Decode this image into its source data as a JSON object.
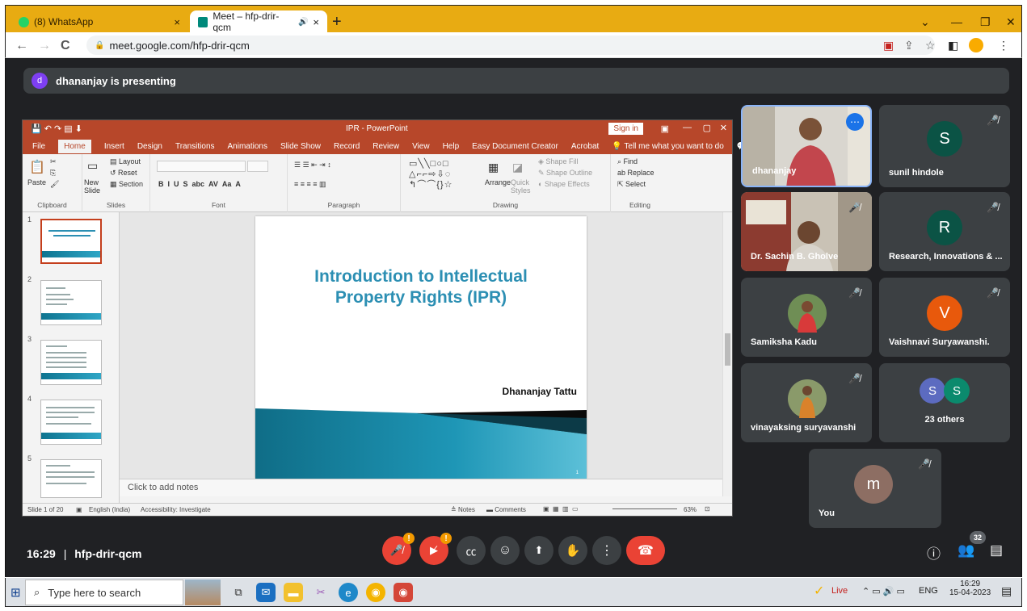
{
  "browser": {
    "tabs": [
      {
        "label": "(8) WhatsApp",
        "close": "×",
        "color": "#25d366"
      },
      {
        "label": "Meet – hfp-drir-qcm",
        "close": "×",
        "audio": "🔊",
        "color": "#00897b"
      }
    ],
    "new_tab": "+",
    "url": "meet.google.com/hfp-drir-qcm",
    "frame_color": "#e8ab12"
  },
  "meet": {
    "presenter_initial": "d",
    "presenting_text": "dhananjay is presenting",
    "time": "16:29",
    "separator": "|",
    "meeting_code": "hfp-drir-qcm",
    "participants_badge": "32",
    "warn_glyph": "!",
    "tiles": [
      {
        "name": "dhananjay",
        "type": "video"
      },
      {
        "name": "sunil hindole",
        "initial": "S",
        "color": "#0b5345"
      },
      {
        "name": "Dr. Sachin B. Gholve",
        "type": "video"
      },
      {
        "name": "Research, Innovations & ...",
        "initial": "R",
        "color": "#0b5345"
      },
      {
        "name": "Samiksha Kadu",
        "type": "photo"
      },
      {
        "name": "Vaishnavi Suryawanshi.",
        "initial": "V",
        "color": "#e8590c"
      },
      {
        "name": "vinayaksing suryavanshi",
        "type": "photo"
      },
      {
        "name": "23 others",
        "initials": [
          "S",
          "S"
        ],
        "colors": [
          "#5c6bc0",
          "#0b8a6d"
        ]
      },
      {
        "name": "You",
        "initial": "m",
        "color": "#8d6e63"
      }
    ]
  },
  "ppt": {
    "title": "IPR - PowerPoint",
    "sign_in": "Sign in",
    "menu": [
      "File",
      "Home",
      "Insert",
      "Design",
      "Transitions",
      "Animations",
      "Slide Show",
      "Record",
      "Review",
      "View",
      "Help",
      "Easy Document Creator",
      "Acrobat",
      "Tell me what you want to do"
    ],
    "ribbon": {
      "paste": "Paste",
      "layout": "Layout",
      "reset": "Reset",
      "new_slide": "New Slide",
      "section": "Section",
      "arrange": "Arrange",
      "quick_styles": "Quick Styles",
      "shape_fill": "Shape Fill",
      "shape_outline": "Shape Outline",
      "shape_effects": "Shape Effects",
      "find": "Find",
      "replace": "Replace",
      "select": "Select",
      "groups": [
        "Clipboard",
        "Slides",
        "Font",
        "Paragraph",
        "Drawing",
        "Editing"
      ]
    },
    "slide": {
      "title": "Introduction to Intellectual Property Rights (IPR)",
      "author": "Dhananjay Tattu",
      "page_num": "1"
    },
    "thumbnail_numbers": [
      "1",
      "2",
      "3",
      "4",
      "5"
    ],
    "notes_placeholder": "Click to add notes",
    "status": {
      "slide_info": "Slide 1 of 20",
      "language": "English (India)",
      "accessibility": "Accessibility: Investigate",
      "notes": "Notes",
      "comments": "Comments",
      "zoom": "63%"
    }
  },
  "taskbar": {
    "search_placeholder": "Type here to search",
    "live_label": "Live",
    "lang": "ENG",
    "time": "16:29",
    "date": "15-04-2023"
  }
}
